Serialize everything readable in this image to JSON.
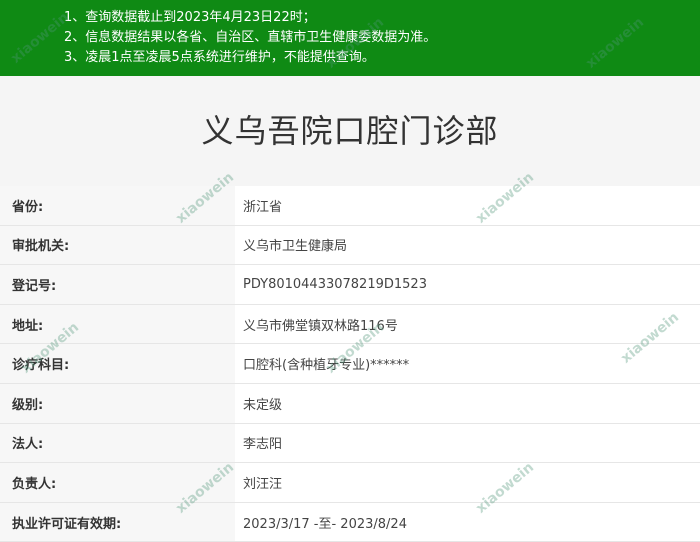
{
  "notice": {
    "lines": [
      "1、查询数据截止到2023年4月23日22时；",
      "2、信息数据结果以各省、自治区、直辖市卫生健康委数据为准。",
      "3、凌晨1点至凌晨5点系统进行维护，不能提供查询。"
    ]
  },
  "title": "义乌吾院口腔门诊部",
  "records": [
    {
      "label": "省份:",
      "value": "浙江省"
    },
    {
      "label": "审批机关:",
      "value": "义乌市卫生健康局"
    },
    {
      "label": "登记号:",
      "value": "PDY80104433078219D1523"
    },
    {
      "label": "地址:",
      "value": "义乌市佛堂镇双林路116号"
    },
    {
      "label": "诊疗科目:",
      "value": "口腔科(含种植牙专业)******"
    },
    {
      "label": "级别:",
      "value": "未定级"
    },
    {
      "label": "法人:",
      "value": "李志阳"
    },
    {
      "label": "负责人:",
      "value": "刘汪汪"
    },
    {
      "label": "执业许可证有效期:",
      "value": "2023/3/17 -至- 2023/8/24"
    }
  ],
  "watermark": "xiaowein",
  "colors": {
    "notice_bg": "#0f8a14",
    "notice_text": "#ffffff"
  }
}
